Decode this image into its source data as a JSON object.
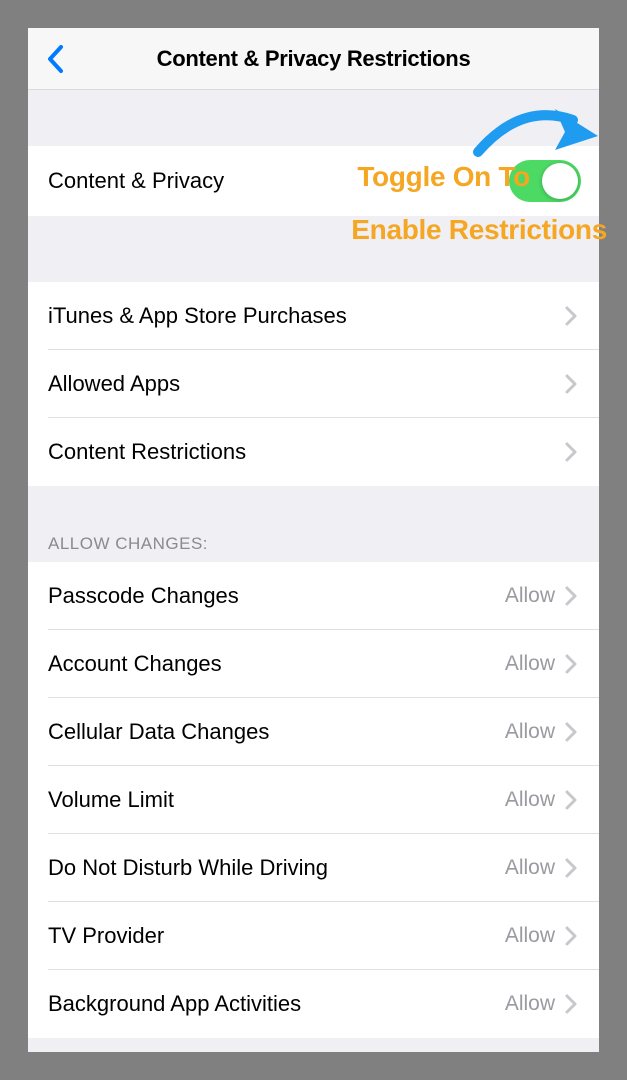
{
  "nav": {
    "title": "Content & Privacy Restrictions"
  },
  "main_toggle": {
    "label": "Content & Privacy",
    "state": "on"
  },
  "annotation": {
    "line1": "Toggle On To",
    "line2": "Enable Restrictions"
  },
  "section1": {
    "items": [
      {
        "label": "iTunes & App Store Purchases"
      },
      {
        "label": "Allowed Apps"
      },
      {
        "label": "Content Restrictions"
      }
    ]
  },
  "section2": {
    "header": "ALLOW CHANGES:",
    "items": [
      {
        "label": "Passcode Changes",
        "value": "Allow"
      },
      {
        "label": "Account Changes",
        "value": "Allow"
      },
      {
        "label": "Cellular Data Changes",
        "value": "Allow"
      },
      {
        "label": "Volume Limit",
        "value": "Allow"
      },
      {
        "label": "Do Not Disturb While Driving",
        "value": "Allow"
      },
      {
        "label": "TV Provider",
        "value": "Allow"
      },
      {
        "label": "Background App Activities",
        "value": "Allow"
      }
    ]
  }
}
